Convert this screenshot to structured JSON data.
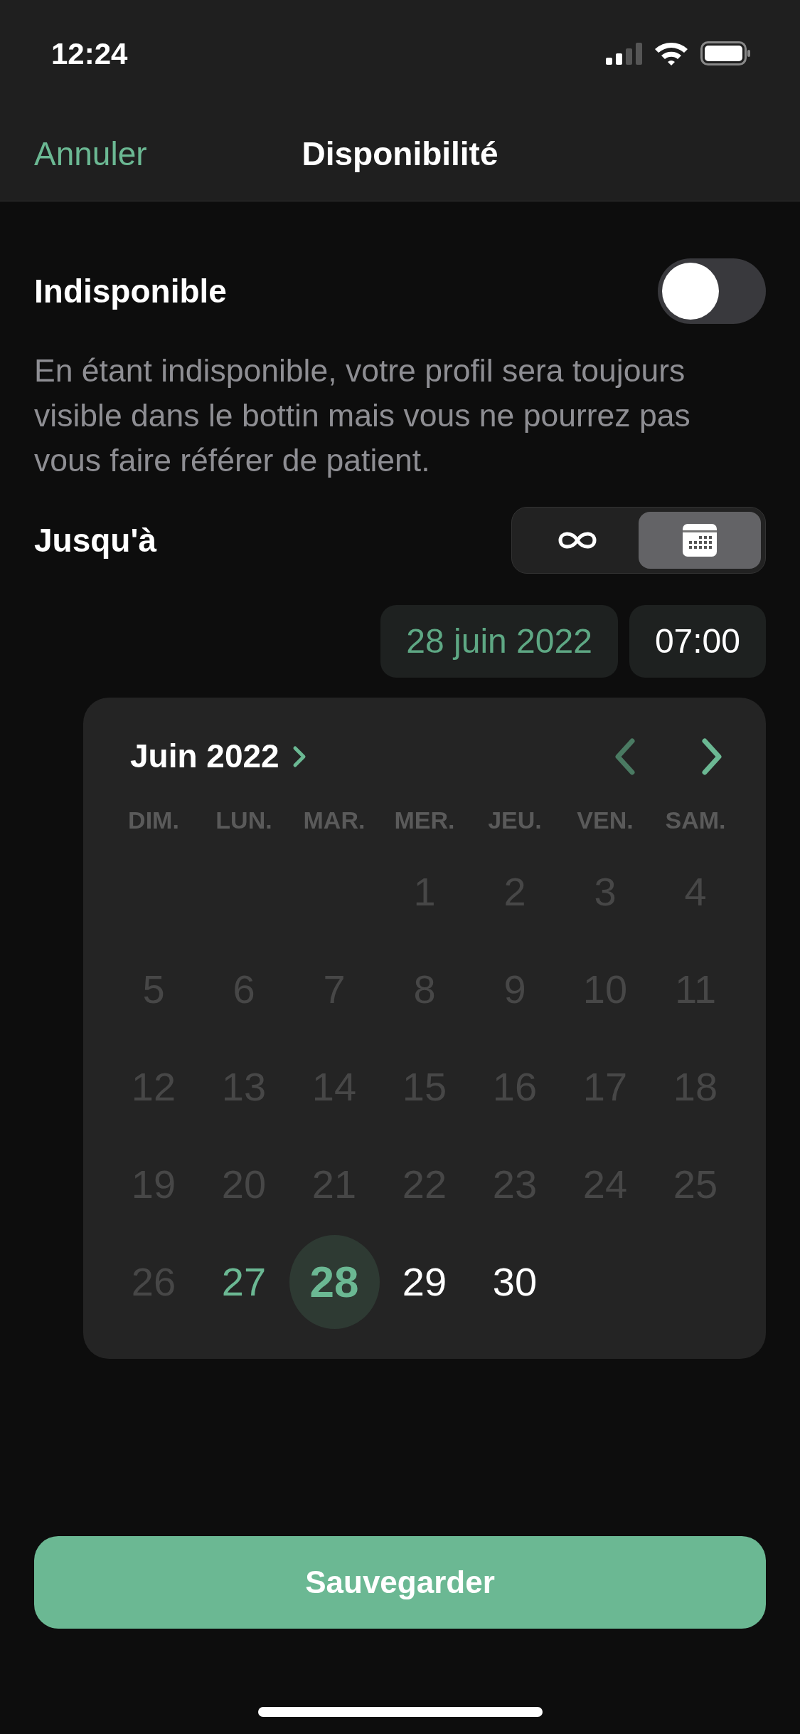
{
  "status_bar": {
    "time": "12:24"
  },
  "nav": {
    "cancel": "Annuler",
    "title": "Disponibilité"
  },
  "unavailable": {
    "label": "Indisponible",
    "on": false,
    "description": "En étant indisponible, votre profil sera toujours visible dans le bottin mais vous ne pourrez pas vous faire référer de patient."
  },
  "until": {
    "label": "Jusqu'à",
    "options": [
      {
        "kind": "infinity",
        "selected": false
      },
      {
        "kind": "calendar",
        "selected": true
      }
    ],
    "date": "28 juin 2022",
    "time": "07:00"
  },
  "calendar": {
    "month": "Juin 2022",
    "prev_disabled": true,
    "next_disabled": false,
    "weekdays": [
      "DIM.",
      "LUN.",
      "MAR.",
      "MER.",
      "JEU.",
      "VEN.",
      "SAM."
    ],
    "weeks": [
      [
        {
          "label": "1",
          "disabled": true,
          "today": false,
          "selected": false
        },
        {
          "label": "2",
          "disabled": true,
          "today": false,
          "selected": false
        },
        {
          "label": "3",
          "disabled": true,
          "today": false,
          "selected": false
        },
        {
          "label": "4",
          "disabled": true,
          "today": false,
          "selected": false
        }
      ],
      [
        {
          "label": "5",
          "disabled": true,
          "today": false,
          "selected": false
        },
        {
          "label": "6",
          "disabled": true,
          "today": false,
          "selected": false
        },
        {
          "label": "7",
          "disabled": true,
          "today": false,
          "selected": false
        },
        {
          "label": "8",
          "disabled": true,
          "today": false,
          "selected": false
        },
        {
          "label": "9",
          "disabled": true,
          "today": false,
          "selected": false
        },
        {
          "label": "10",
          "disabled": true,
          "today": false,
          "selected": false
        },
        {
          "label": "11",
          "disabled": true,
          "today": false,
          "selected": false
        }
      ],
      [
        {
          "label": "12",
          "disabled": true,
          "today": false,
          "selected": false
        },
        {
          "label": "13",
          "disabled": true,
          "today": false,
          "selected": false
        },
        {
          "label": "14",
          "disabled": true,
          "today": false,
          "selected": false
        },
        {
          "label": "15",
          "disabled": true,
          "today": false,
          "selected": false
        },
        {
          "label": "16",
          "disabled": true,
          "today": false,
          "selected": false
        },
        {
          "label": "17",
          "disabled": true,
          "today": false,
          "selected": false
        },
        {
          "label": "18",
          "disabled": true,
          "today": false,
          "selected": false
        }
      ],
      [
        {
          "label": "19",
          "disabled": true,
          "today": false,
          "selected": false
        },
        {
          "label": "20",
          "disabled": true,
          "today": false,
          "selected": false
        },
        {
          "label": "21",
          "disabled": true,
          "today": false,
          "selected": false
        },
        {
          "label": "22",
          "disabled": true,
          "today": false,
          "selected": false
        },
        {
          "label": "23",
          "disabled": true,
          "today": false,
          "selected": false
        },
        {
          "label": "24",
          "disabled": true,
          "today": false,
          "selected": false
        },
        {
          "label": "25",
          "disabled": true,
          "today": false,
          "selected": false
        }
      ],
      [
        {
          "label": "26",
          "disabled": true,
          "today": false,
          "selected": false
        },
        {
          "label": "27",
          "disabled": false,
          "today": true,
          "selected": false
        },
        {
          "label": "28",
          "disabled": false,
          "today": false,
          "selected": true
        },
        {
          "label": "29",
          "disabled": false,
          "today": false,
          "selected": false
        },
        {
          "label": "30",
          "disabled": false,
          "today": false,
          "selected": false
        }
      ]
    ]
  },
  "save_button": "Sauvegarder"
}
